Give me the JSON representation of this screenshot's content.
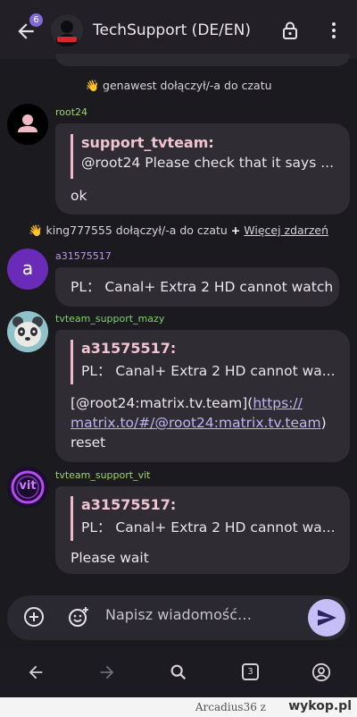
{
  "header": {
    "title": "TechSupport (DE/EN)",
    "badge_count": "6",
    "avatar_text": "SUPPORT"
  },
  "events": {
    "join1": "genawest dołączył/-a do czatu",
    "join2": "king777555 dołączył/-a do czatu",
    "plus": "+",
    "more_events": "Więcej zdarzeń",
    "wave": "👋"
  },
  "messages": [
    {
      "sender": "root24",
      "sender_color": "#9fd36a",
      "quote_name": "support_tvteam:",
      "quote_text": "@root24 Please check that it says ...",
      "text": "ok"
    },
    {
      "sender": "a31575517",
      "sender_color": "#b999f2",
      "avatar_letter": "a",
      "text": "PL： Canal+ Extra 2 HD cannot watch"
    },
    {
      "sender": "tvteam_support_mazy",
      "sender_color": "#7ad46b",
      "quote_name": "a31575517:",
      "quote_text": "PL： Canal+ Extra 2 HD cannot wa...",
      "text_prefix": "[@root24:matrix.tv.team](",
      "link_line1": "https://",
      "link_line2": "matrix.to/#/@root24:matrix.tv.team",
      "text_suffix": ")",
      "text_line3": "reset"
    },
    {
      "sender": "tvteam_support_vit",
      "sender_color": "#9fd36a",
      "avatar_text": "vit",
      "quote_name": "a31575517:",
      "quote_text": "PL： Canal+ Extra 2 HD cannot wa...",
      "text": "Please wait"
    }
  ],
  "composer": {
    "placeholder": "Napisz wiadomość…"
  },
  "navbar": {
    "tab_count": "3"
  },
  "watermark": {
    "author": "Arcadius36",
    "separator": "z",
    "site": "wykop.pl"
  },
  "colors": {
    "accent": "#c6bff7",
    "quote_bar": "#f0b9c7",
    "bubble": "#2f2c34"
  }
}
